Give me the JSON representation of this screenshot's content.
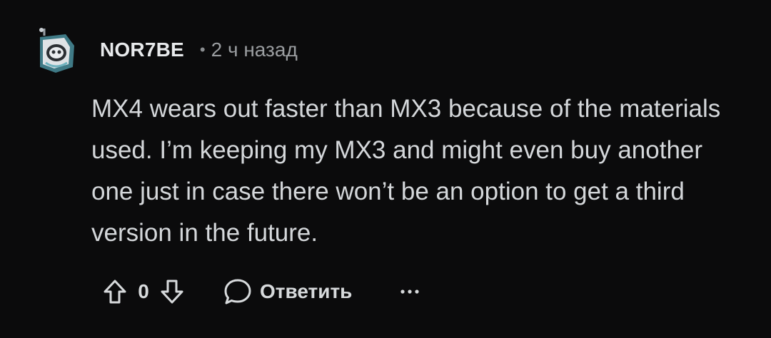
{
  "comment": {
    "author": "NOR7BE",
    "separator": "•",
    "time": "2 ч назад",
    "body": "MX4 wears out faster than MX3 because of the materials used. I’m keeping my MX3 and might even buy another one just in case there won’t be an option to get a third version in the future.",
    "avatar_icon": "robot-avatar-icon",
    "actions": {
      "upvote_icon": "arrow-up-icon",
      "score": "0",
      "downvote_icon": "arrow-down-icon",
      "reply_icon": "speech-bubble-icon",
      "reply_label": "Ответить",
      "more_icon": "ellipsis-icon"
    }
  },
  "colors": {
    "background": "#0b0b0c",
    "text": "#d7dadc",
    "muted": "#9a9da0"
  }
}
